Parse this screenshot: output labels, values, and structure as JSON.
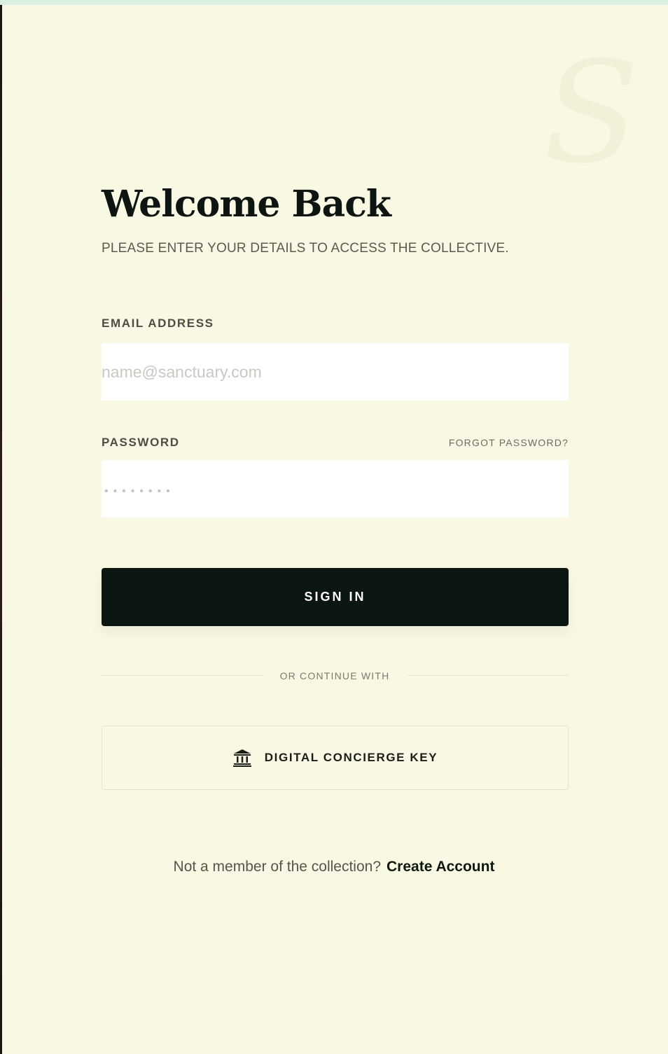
{
  "brand": {
    "watermark": "S"
  },
  "header": {
    "title": "Welcome Back",
    "subtitle": "PLEASE ENTER YOUR DETAILS TO ACCESS THE COLLECTIVE."
  },
  "form": {
    "email": {
      "label": "EMAIL ADDRESS",
      "value": "",
      "placeholder": "name@sanctuary.com"
    },
    "password": {
      "label": "PASSWORD",
      "value": "",
      "placeholder": "••••••••",
      "forgot_label": "FORGOT PASSWORD?"
    },
    "submit_label": "SIGN IN"
  },
  "alternative": {
    "divider_text": "OR CONTINUE WITH",
    "concierge_label": "DIGITAL CONCIERGE KEY",
    "concierge_icon": "bank-icon"
  },
  "footer": {
    "prompt": "Not a member of the collection?",
    "link_label": "Create Account"
  },
  "colors": {
    "background": "#f9f9e3",
    "primary": "#0b1612",
    "text_muted": "#5a5a50",
    "field_background": "#ffffff"
  }
}
